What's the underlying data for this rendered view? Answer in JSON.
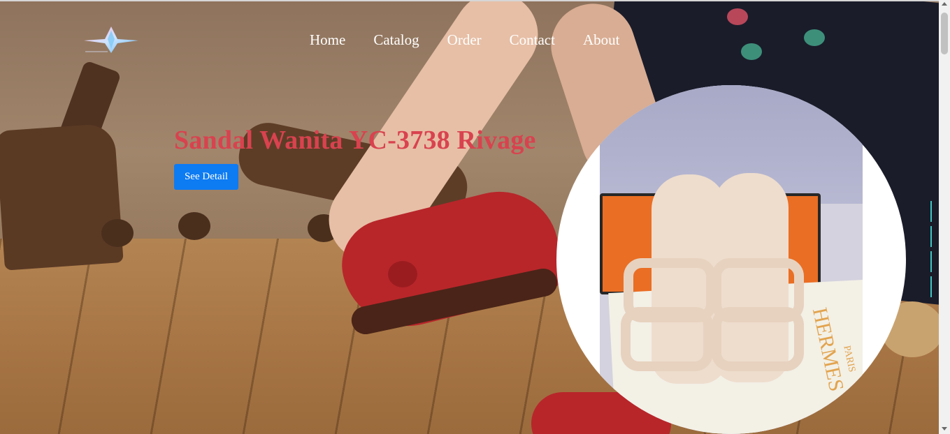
{
  "nav": {
    "items": [
      {
        "label": "Home"
      },
      {
        "label": "Catalog"
      },
      {
        "label": "Order"
      },
      {
        "label": "Contact"
      },
      {
        "label": "About"
      }
    ]
  },
  "hero": {
    "title": "Sandal Wanita YC-3738 Rivage",
    "button_label": "See Detail",
    "accent_color": "#d9424f",
    "button_color": "#0d7bf2"
  },
  "product_image": {
    "brand_text": "HERMES",
    "brand_subtext": "PARIS"
  },
  "carousel": {
    "indicator_color": "#3fc6c0",
    "indicator_count": 4
  },
  "icons": {
    "logo": "diamond-star-logo-icon"
  }
}
